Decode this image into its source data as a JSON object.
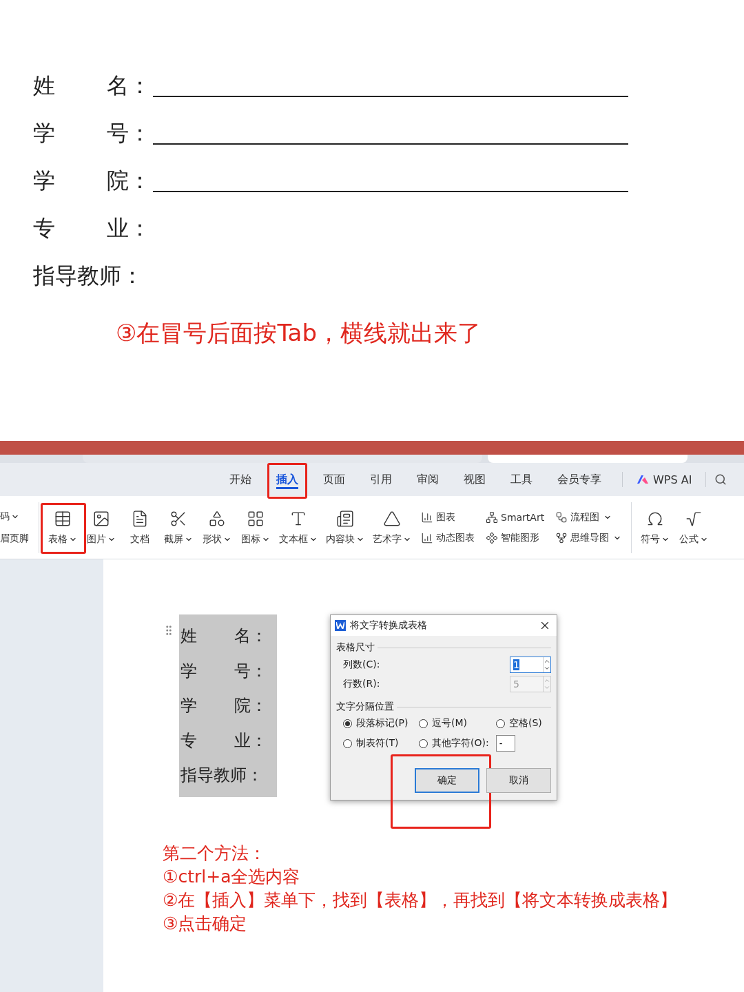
{
  "form": [
    {
      "label": "姓",
      "label_end": "名：",
      "blank": true
    },
    {
      "label": "学",
      "label_end": "号：",
      "blank": true
    },
    {
      "label": "学",
      "label_end": "院：",
      "blank": true
    },
    {
      "label": "专",
      "label_end": "业：",
      "blank": false
    },
    {
      "label": "指导教师：",
      "blank": false
    }
  ],
  "caption": "③在冒号后面按Tab，横线就出来了",
  "tabs": [
    {
      "label": "开始",
      "selected": false,
      "highlighted": false
    },
    {
      "label": "插入",
      "selected": true,
      "highlighted": true
    },
    {
      "label": "页面",
      "selected": false,
      "highlighted": false
    },
    {
      "label": "引用",
      "selected": false,
      "highlighted": false
    },
    {
      "label": "审阅",
      "selected": false,
      "highlighted": false
    },
    {
      "label": "视图",
      "selected": false,
      "highlighted": false
    },
    {
      "label": "工具",
      "selected": false,
      "highlighted": false
    },
    {
      "label": "会员专享",
      "selected": false,
      "highlighted": false
    }
  ],
  "wps_ai": "WPS AI",
  "ribbon_cut": [
    {
      "label": "码",
      "caret": true
    },
    {
      "label": "眉页脚",
      "caret": false
    }
  ],
  "ribbon_large": [
    {
      "label": "表格",
      "caret": true,
      "highlighted": true
    },
    {
      "label": "图片",
      "caret": true,
      "highlighted": false
    },
    {
      "label": "文档",
      "caret": false,
      "highlighted": false
    },
    {
      "label": "截屏",
      "caret": true,
      "highlighted": false
    },
    {
      "label": "形状",
      "caret": true,
      "highlighted": false
    },
    {
      "label": "图标",
      "caret": true,
      "highlighted": false
    },
    {
      "label": "文本框",
      "caret": true,
      "highlighted": false
    },
    {
      "label": "内容块",
      "caret": true,
      "highlighted": false
    },
    {
      "label": "艺术字",
      "caret": true,
      "highlighted": false
    }
  ],
  "ribbon_small": [
    [
      {
        "label": "图表",
        "caret": false
      },
      {
        "label": "动态图表",
        "caret": false
      }
    ],
    [
      {
        "label": "SmartArt",
        "caret": false
      },
      {
        "label": "智能图形",
        "caret": false
      }
    ],
    [
      {
        "label": "流程图",
        "caret": true
      },
      {
        "label": "思维导图",
        "caret": true
      }
    ]
  ],
  "ribbon_right": [
    {
      "label": "符号",
      "caret": true
    },
    {
      "label": "公式",
      "caret": true
    }
  ],
  "selection": [
    {
      "label": "姓",
      "label_end": "名："
    },
    {
      "label": "学",
      "label_end": "号："
    },
    {
      "label": "学",
      "label_end": "院："
    },
    {
      "label": "专",
      "label_end": "业："
    },
    {
      "label": "指导教师："
    }
  ],
  "dialog": {
    "title": "将文字转换成表格",
    "size_section": "表格尺寸",
    "fields": [
      {
        "label": "列数(C):",
        "value": "1",
        "disabled": false
      },
      {
        "label": "行数(R):",
        "value": "5",
        "disabled": true
      }
    ],
    "separator_section": "文字分隔位置",
    "radios": [
      {
        "label": "段落标记(P)",
        "selected": true
      },
      {
        "label": "逗号(M)",
        "selected": false
      },
      {
        "label": "空格(S)",
        "selected": false
      },
      {
        "label": "制表符(T)",
        "selected": false
      },
      {
        "label": "其他字符(O):",
        "selected": false
      }
    ],
    "other_value": "-",
    "buttons": [
      {
        "label": "确定",
        "default": true,
        "highlighted": true
      },
      {
        "label": "取消",
        "default": false,
        "highlighted": false
      }
    ]
  },
  "notes": [
    "第二个方法：",
    "①ctrl+a全选内容",
    "②在【插入】菜单下，找到【表格】，再找到【将文本转换成表格】",
    "③点击确定"
  ]
}
